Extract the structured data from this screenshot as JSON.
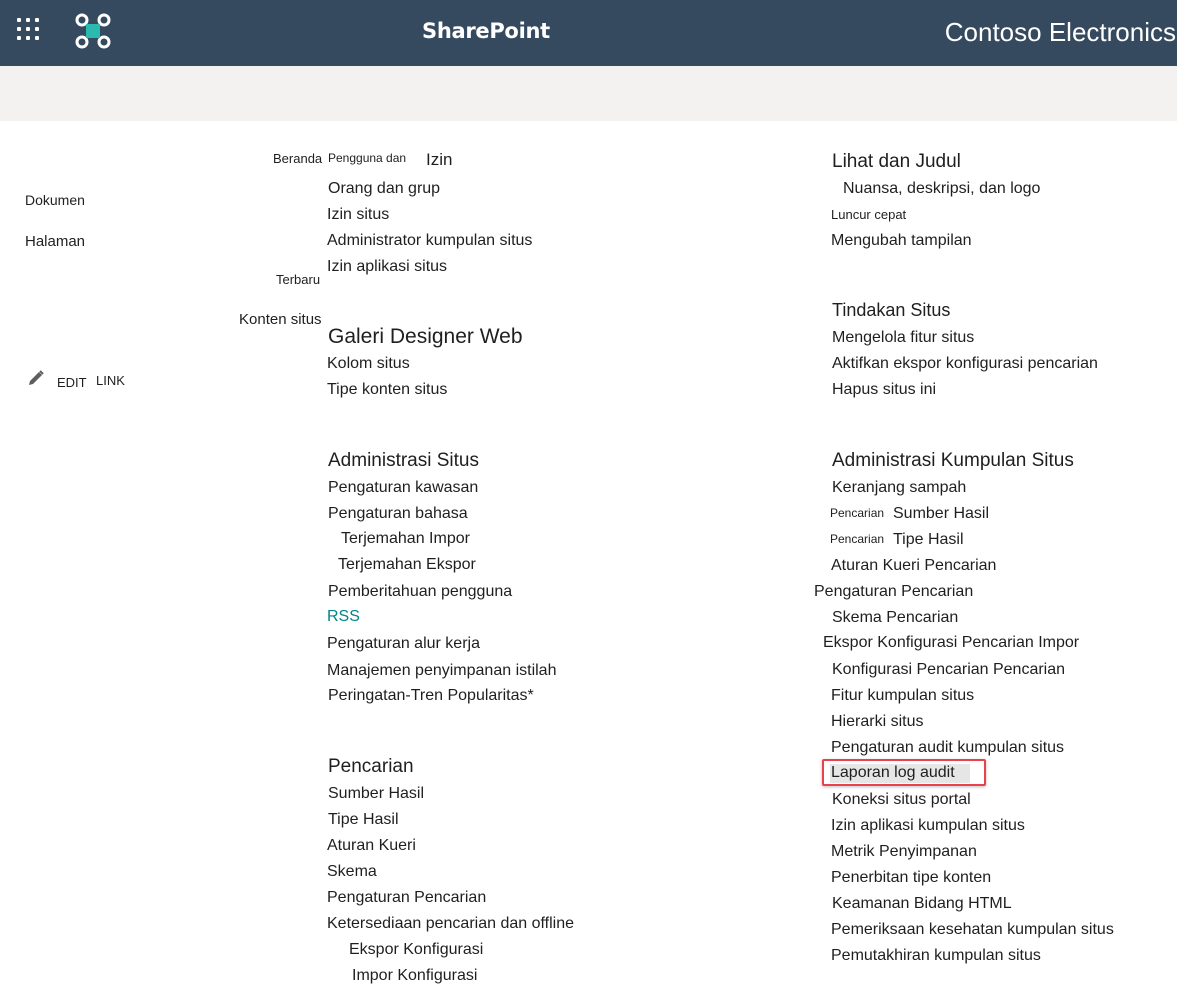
{
  "suite_bar": {
    "app_title": "SharePoint",
    "tenant_name": "Contoso Electronics",
    "waffle_icon": "app-launcher-icon",
    "logo_icon": "sharepoint-logo-icon",
    "background": "#364a5f"
  },
  "left_nav": {
    "documents": "Dokumen",
    "pages": "Halaman",
    "recent": "Terbaru",
    "site_contents": "Konten situs",
    "edit_links": {
      "edit": "EDIT",
      "link": "LINK",
      "icon": "pencil-icon"
    }
  },
  "breadcrumb": {
    "home": "Beranda",
    "users_prefix": "Pengguna dan"
  },
  "sections": {
    "users_permissions": {
      "heading": "Izin",
      "links": [
        "Orang dan grup",
        "Izin situs",
        "Administrator kumpulan situs",
        "Izin aplikasi situs"
      ]
    },
    "web_designer_galleries": {
      "heading": "Galeri Designer Web",
      "links": [
        "Kolom situs",
        "Tipe konten situs"
      ]
    },
    "site_administration": {
      "heading": "Administrasi Situs",
      "links": [
        "Pengaturan kawasan",
        "Pengaturan bahasa",
        "Terjemahan Impor",
        "Terjemahan Ekspor",
        "Pemberitahuan pengguna",
        "RSS",
        "Pengaturan alur kerja",
        "Manajemen penyimpanan istilah",
        "Peringatan-Tren Popularitas*"
      ]
    },
    "search": {
      "heading": "Pencarian",
      "links": [
        "Sumber Hasil",
        "Tipe Hasil",
        "Aturan Kueri",
        "Skema",
        "Pengaturan Pencarian",
        "Ketersediaan pencarian dan offline",
        "Ekspor Konfigurasi",
        "Impor Konfigurasi"
      ]
    },
    "look_and_feel": {
      "heading": "Lihat dan Judul",
      "links": [
        "Nuansa, deskripsi, dan logo",
        "Luncur cepat",
        "Mengubah tampilan"
      ]
    },
    "site_actions": {
      "heading": "Tindakan Situs",
      "links": [
        "Mengelola fitur situs",
        "Aktifkan ekspor konfigurasi pencarian",
        "Hapus situs ini"
      ]
    },
    "site_collection_admin": {
      "heading": "Administrasi Kumpulan Situs",
      "prefix": "Pencarian",
      "links": [
        "Keranjang sampah",
        "Sumber Hasil",
        "Tipe Hasil",
        "Aturan Kueri Pencarian",
        "Pengaturan Pencarian",
        "Skema Pencarian",
        "Ekspor Konfigurasi Pencarian Impor",
        "Konfigurasi Pencarian Pencarian",
        "Fitur kumpulan situs",
        "Hierarki situs",
        "Pengaturan audit kumpulan situs",
        "Laporan log audit",
        "Koneksi situs portal",
        "Izin aplikasi kumpulan situs",
        "Metrik Penyimpanan",
        "Penerbitan tipe konten",
        "Keamanan Bidang HTML",
        "Pemeriksaan kesehatan kumpulan situs",
        "Pemutakhiran kumpulan situs"
      ]
    }
  },
  "colors": {
    "accent_link": "#038387",
    "highlight_border": "#e8424c"
  }
}
